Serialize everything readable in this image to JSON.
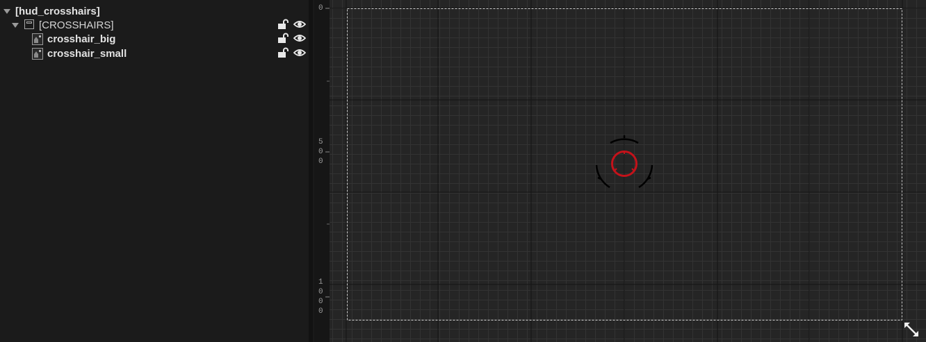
{
  "hierarchy": {
    "root_label": "[hud_crosshairs]",
    "canvas_label": "[CROSSHAIRS]",
    "items": [
      {
        "label": "crosshair_big"
      },
      {
        "label": "crosshair_small"
      }
    ]
  },
  "designer": {
    "ruler_labels": [
      {
        "value": "0",
        "digits": [
          "0"
        ]
      },
      {
        "value": "500",
        "digits": [
          "5",
          "0",
          "0"
        ]
      },
      {
        "value": "1000",
        "digits": [
          "1",
          "0",
          "0",
          "0"
        ]
      }
    ]
  },
  "colors": {
    "crosshair_small": "#c4121a",
    "crosshair_big": "#000000",
    "selection_outline": "#cfcfcf"
  }
}
